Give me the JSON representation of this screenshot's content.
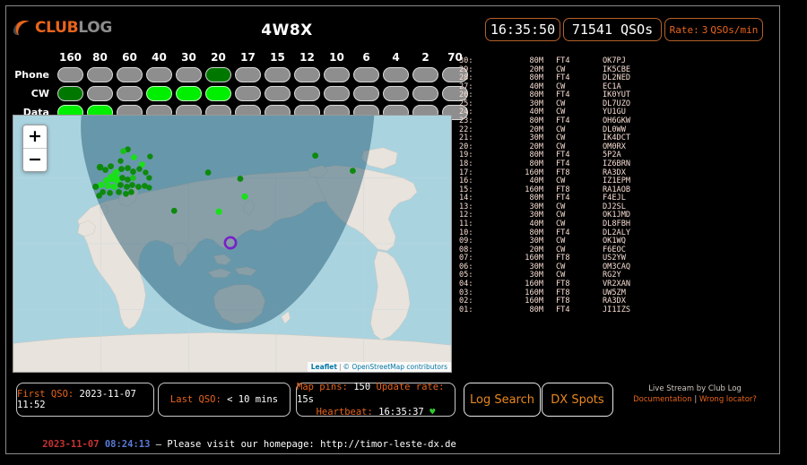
{
  "header": {
    "logo_club": "CLUB",
    "logo_log": "LOG",
    "callsign": "4W8X",
    "clock": "16:35:50",
    "qso_count": "71541 QSOs",
    "rate_label": "Rate:",
    "rate_value": "3",
    "rate_unit": "QSOs/min"
  },
  "bands": {
    "columns": [
      "160",
      "80",
      "60",
      "40",
      "30",
      "20",
      "17",
      "15",
      "12",
      "10",
      "6",
      "4",
      "2",
      "70"
    ],
    "rows": [
      {
        "label": "Phone",
        "states": [
          "off",
          "off",
          "off",
          "off",
          "off",
          "worked",
          "off",
          "off",
          "off",
          "off",
          "off",
          "off",
          "off",
          "off"
        ]
      },
      {
        "label": "CW",
        "states": [
          "worked",
          "off",
          "off",
          "on",
          "on",
          "on",
          "off",
          "off",
          "off",
          "off",
          "off",
          "off",
          "off",
          "off"
        ]
      },
      {
        "label": "Data",
        "states": [
          "on",
          "on",
          "off",
          "off",
          "off",
          "off",
          "off",
          "off",
          "off",
          "off",
          "off",
          "off",
          "off",
          "off"
        ]
      }
    ]
  },
  "map": {
    "zoom_in": "+",
    "zoom_out": "−",
    "attribution_leaflet": "Leaflet",
    "attribution_sep": "|",
    "attribution_osm": "© OpenStreetMap contributors",
    "ocean_color": "#aad3e0",
    "land_color": "#e8e3dc",
    "night_color": "#3f6c80",
    "pin_color_recent": "#00ee00",
    "pin_color_old": "#0d8a0d",
    "home_marker_color": "#7a20c8"
  },
  "qso_list": [
    {
      "idx": "30:",
      "band": "80M",
      "mode": "FT4",
      "call": "OK7PJ"
    },
    {
      "idx": "29:",
      "band": "20M",
      "mode": "CW",
      "call": "IK5CBE"
    },
    {
      "idx": "28:",
      "band": "80M",
      "mode": "FT4",
      "call": "DL2NED"
    },
    {
      "idx": "27:",
      "band": "40M",
      "mode": "CW",
      "call": "EC1A"
    },
    {
      "idx": "26:",
      "band": "80M",
      "mode": "FT4",
      "call": "IK0YUT"
    },
    {
      "idx": "25:",
      "band": "30M",
      "mode": "CW",
      "call": "DL7UZO"
    },
    {
      "idx": "24:",
      "band": "40M",
      "mode": "CW",
      "call": "YU1GU"
    },
    {
      "idx": "23:",
      "band": "80M",
      "mode": "FT4",
      "call": "OH6GKW"
    },
    {
      "idx": "22:",
      "band": "20M",
      "mode": "CW",
      "call": "DL0WW"
    },
    {
      "idx": "21:",
      "band": "30M",
      "mode": "CW",
      "call": "IK4DCT"
    },
    {
      "idx": "20:",
      "band": "20M",
      "mode": "CW",
      "call": "OM0RX"
    },
    {
      "idx": "19:",
      "band": "80M",
      "mode": "FT4",
      "call": "5P2A"
    },
    {
      "idx": "18:",
      "band": "80M",
      "mode": "FT4",
      "call": "IZ6BRN"
    },
    {
      "idx": "17:",
      "band": "160M",
      "mode": "FT8",
      "call": "RA3DX"
    },
    {
      "idx": "16:",
      "band": "40M",
      "mode": "CW",
      "call": "IZ1EPM"
    },
    {
      "idx": "15:",
      "band": "160M",
      "mode": "FT8",
      "call": "RA1AOB"
    },
    {
      "idx": "14:",
      "band": "80M",
      "mode": "FT4",
      "call": "F4EJL"
    },
    {
      "idx": "13:",
      "band": "30M",
      "mode": "CW",
      "call": "DJ2SL"
    },
    {
      "idx": "12:",
      "band": "30M",
      "mode": "CW",
      "call": "OK1JMD"
    },
    {
      "idx": "11:",
      "band": "40M",
      "mode": "CW",
      "call": "DL8FBH"
    },
    {
      "idx": "10:",
      "band": "80M",
      "mode": "FT4",
      "call": "DL2ALY"
    },
    {
      "idx": "09:",
      "band": "30M",
      "mode": "CW",
      "call": "OK1WQ"
    },
    {
      "idx": "08:",
      "band": "20M",
      "mode": "CW",
      "call": "F6EOC"
    },
    {
      "idx": "07:",
      "band": "160M",
      "mode": "FT8",
      "call": "US2YW"
    },
    {
      "idx": "06:",
      "band": "30M",
      "mode": "CW",
      "call": "OM3CAQ"
    },
    {
      "idx": "05:",
      "band": "30M",
      "mode": "CW",
      "call": "RG2Y"
    },
    {
      "idx": "04:",
      "band": "160M",
      "mode": "FT8",
      "call": "VR2XAN"
    },
    {
      "idx": "03:",
      "band": "160M",
      "mode": "FT8",
      "call": "UW5ZM"
    },
    {
      "idx": "02:",
      "band": "160M",
      "mode": "FT8",
      "call": "RA3DX"
    },
    {
      "idx": "01:",
      "band": "80M",
      "mode": "FT4",
      "call": "JI1IZS"
    }
  ],
  "status": {
    "first_qso_label": "First QSO:",
    "first_qso_value": "2023-11-07 11:52",
    "last_qso_label": "Last QSO:",
    "last_qso_value": "< 10 mins",
    "map_pins_label": "Map pins:",
    "map_pins_value": "150",
    "update_rate_label": "Update rate:",
    "update_rate_value": "15s",
    "heartbeat_label": "Heartbeat:",
    "heartbeat_value": "16:35:37",
    "heartbeat_icon": "♥"
  },
  "actions": {
    "log_search": "Log Search",
    "dx_spots": "DX Spots"
  },
  "credits": {
    "line1": "Live Stream by Club Log",
    "documentation": "Documentation",
    "separator": "|",
    "wrong_locator": "Wrong locator?"
  },
  "ticker": {
    "date": "2023-11-07",
    "time": "08:24:13",
    "message": " – Please visit our homepage: http://timor-leste-dx.de"
  }
}
